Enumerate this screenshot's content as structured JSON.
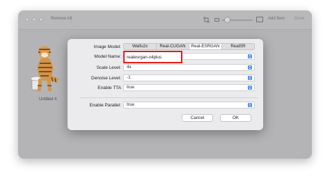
{
  "window": {
    "title": "Remove All"
  },
  "toolbar": {
    "add_item": "Add Item",
    "done": "Done"
  },
  "item": {
    "label": "Untitled 4"
  },
  "dialog": {
    "image_model": {
      "label": "Image Model:",
      "options": [
        "Waifu2x",
        "Real-CUGAN",
        "Real-ESRGAN",
        "RealSR"
      ],
      "selected": "Real-ESRGAN"
    },
    "model_name": {
      "label": "Model Name:",
      "value": "realesrgan-x4plus"
    },
    "scale_level": {
      "label": "Scale Level:",
      "value": "4x"
    },
    "denoise_level": {
      "label": "Denoise Level:",
      "value": "-1"
    },
    "enable_tta": {
      "label": "Enable TTA",
      "value": "true"
    },
    "enable_parallel": {
      "label": "Enable Parallel:",
      "value": "true"
    },
    "buttons": {
      "cancel": "Cancel",
      "ok": "OK"
    }
  },
  "colors": {
    "accent": "#3b82f6",
    "highlight": "#e01d1d"
  }
}
